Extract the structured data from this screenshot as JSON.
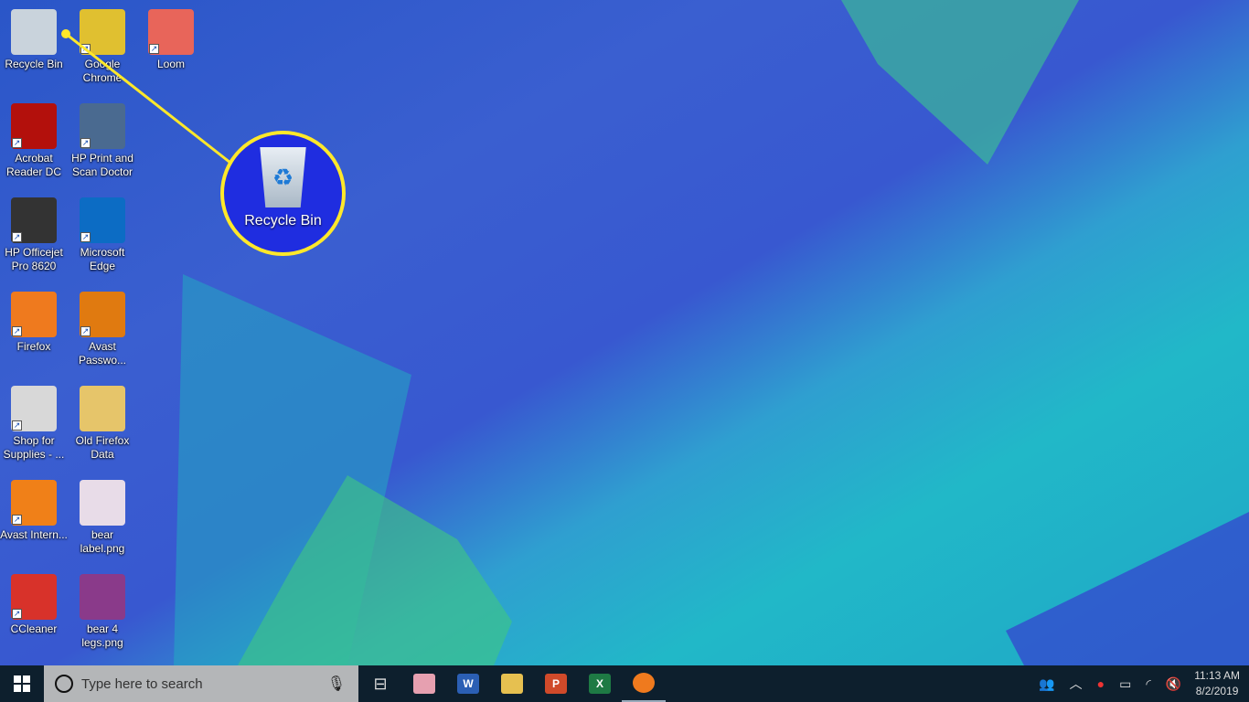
{
  "desktop": {
    "icons": [
      {
        "label": "Recycle Bin",
        "icon": "recycle-bin-icon",
        "color": "#c9d3dc",
        "shortcut": false
      },
      {
        "label": "Google Chrome",
        "icon": "chrome-icon",
        "color": "#e0c030",
        "shortcut": true
      },
      {
        "label": "Loom",
        "icon": "loom-icon",
        "color": "#e8655a",
        "shortcut": true
      },
      {
        "label": "Acrobat Reader DC",
        "icon": "acrobat-icon",
        "color": "#b3100c",
        "shortcut": true
      },
      {
        "label": "HP Print and Scan Doctor",
        "icon": "hp-print-icon",
        "color": "#4a6a90",
        "shortcut": true
      },
      {
        "label": "HP Officejet Pro 8620",
        "icon": "printer-icon",
        "color": "#333333",
        "shortcut": true
      },
      {
        "label": "Microsoft Edge",
        "icon": "edge-icon",
        "color": "#0c6cc4",
        "shortcut": true
      },
      {
        "label": "Firefox",
        "icon": "firefox-icon",
        "color": "#ef7a1e",
        "shortcut": true
      },
      {
        "label": "Avast Passwo...",
        "icon": "avast-passwords-icon",
        "color": "#e07a10",
        "shortcut": true
      },
      {
        "label": "Shop for Supplies - ...",
        "icon": "printer-supplies-icon",
        "color": "#d8d8d8",
        "shortcut": true
      },
      {
        "label": "Old Firefox Data",
        "icon": "folder-icon",
        "color": "#e6c56a",
        "shortcut": false
      },
      {
        "label": "Avast Intern...",
        "icon": "avast-icon",
        "color": "#f08018",
        "shortcut": true
      },
      {
        "label": "bear label.png",
        "icon": "image-file-icon",
        "color": "#e8dce8",
        "shortcut": false
      },
      {
        "label": "CCleaner",
        "icon": "ccleaner-icon",
        "color": "#d8322a",
        "shortcut": true
      },
      {
        "label": "bear 4 legs.png",
        "icon": "image-file-icon",
        "color": "#8a3a8a",
        "shortcut": false
      }
    ]
  },
  "callout": {
    "label": "Recycle Bin",
    "color": "#ffe82a"
  },
  "taskbar": {
    "search_placeholder": "Type here to search",
    "apps": [
      {
        "name": "snipping-tool",
        "icon": "snipping-tool-icon",
        "letter": "",
        "color": "#e6a0b0"
      },
      {
        "name": "word",
        "icon": "word-icon",
        "letter": "W",
        "color": "#2b5fb4"
      },
      {
        "name": "file-explorer",
        "icon": "folder-icon",
        "letter": "",
        "color": "#e6c050"
      },
      {
        "name": "powerpoint",
        "icon": "powerpoint-icon",
        "letter": "P",
        "color": "#d04a2a"
      },
      {
        "name": "excel",
        "icon": "excel-icon",
        "letter": "X",
        "color": "#1e7a44"
      },
      {
        "name": "firefox",
        "icon": "firefox-icon",
        "letter": "",
        "color": "#ef7a1e"
      }
    ],
    "time": "11:13 AM",
    "date": "8/2/2019"
  }
}
